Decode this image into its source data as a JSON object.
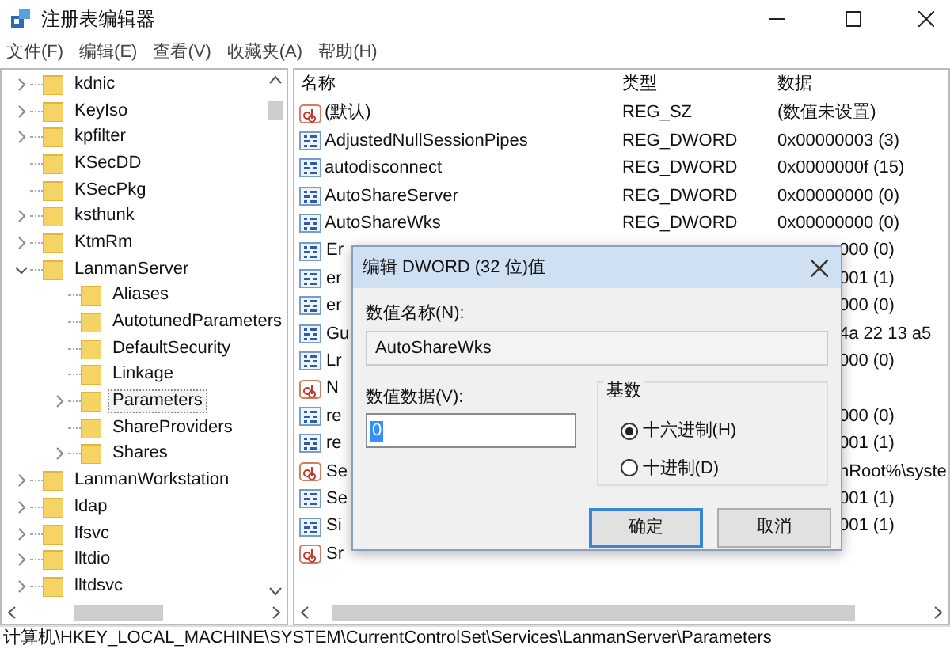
{
  "window": {
    "title": "注册表编辑器"
  },
  "menu": [
    "文件(F)",
    "编辑(E)",
    "查看(V)",
    "收藏夹(A)",
    "帮助(H)"
  ],
  "tree": [
    {
      "label": "kdnic",
      "expandable": true,
      "expanded": false,
      "selected": false
    },
    {
      "label": "KeyIso",
      "expandable": true,
      "expanded": false,
      "selected": false
    },
    {
      "label": "kpfilter",
      "expandable": true,
      "expanded": false,
      "selected": false
    },
    {
      "label": "KSecDD",
      "expandable": false,
      "expanded": false,
      "selected": false
    },
    {
      "label": "KSecPkg",
      "expandable": false,
      "expanded": false,
      "selected": false
    },
    {
      "label": "ksthunk",
      "expandable": true,
      "expanded": false,
      "selected": false
    },
    {
      "label": "KtmRm",
      "expandable": true,
      "expanded": false,
      "selected": false
    },
    {
      "label": "LanmanServer",
      "expandable": true,
      "expanded": true,
      "selected": false,
      "children": [
        {
          "label": "Aliases",
          "expandable": false,
          "expanded": false,
          "selected": false
        },
        {
          "label": "AutotunedParameters",
          "expandable": false,
          "expanded": false,
          "selected": false
        },
        {
          "label": "DefaultSecurity",
          "expandable": false,
          "expanded": false,
          "selected": false
        },
        {
          "label": "Linkage",
          "expandable": false,
          "expanded": false,
          "selected": false
        },
        {
          "label": "Parameters",
          "expandable": true,
          "expanded": false,
          "selected": true
        },
        {
          "label": "ShareProviders",
          "expandable": false,
          "expanded": false,
          "selected": false
        },
        {
          "label": "Shares",
          "expandable": true,
          "expanded": false,
          "selected": false
        }
      ]
    },
    {
      "label": "LanmanWorkstation",
      "expandable": true,
      "expanded": false,
      "selected": false
    },
    {
      "label": "ldap",
      "expandable": true,
      "expanded": false,
      "selected": false
    },
    {
      "label": "lfsvc",
      "expandable": true,
      "expanded": false,
      "selected": false
    },
    {
      "label": "lltdio",
      "expandable": true,
      "expanded": false,
      "selected": false
    },
    {
      "label": "lltdsvc",
      "expandable": true,
      "expanded": false,
      "selected": false
    }
  ],
  "table": {
    "columns": [
      "名称",
      "类型",
      "数据"
    ],
    "rows": [
      {
        "kind": "string",
        "name": "(默认)",
        "type": "REG_SZ",
        "data": "(数值未设置)"
      },
      {
        "kind": "dword",
        "name": "AdjustedNullSessionPipes",
        "type": "REG_DWORD",
        "data": "0x00000003 (3)"
      },
      {
        "kind": "dword",
        "name": "autodisconnect",
        "type": "REG_DWORD",
        "data": "0x0000000f (15)"
      },
      {
        "kind": "dword",
        "name": "AutoShareServer",
        "type": "REG_DWORD",
        "data": "0x00000000 (0)"
      },
      {
        "kind": "dword",
        "name": "AutoShareWks",
        "type": "REG_DWORD",
        "data": "0x00000000 (0)"
      }
    ],
    "rows_behind_dialog": [
      {
        "kind": "dword",
        "name": "Er",
        "data": "000 (0)"
      },
      {
        "kind": "dword",
        "name": "er",
        "data": "001 (1)"
      },
      {
        "kind": "dword",
        "name": "er",
        "data": "000 (0)"
      },
      {
        "kind": "dword",
        "name": "Gu",
        "data": "4a 22 13 a5"
      },
      {
        "kind": "dword",
        "name": "Lr",
        "data": "000 (0)"
      },
      {
        "kind": "string",
        "name": "N"
      },
      {
        "kind": "dword",
        "name": "re",
        "data": "000 (0)"
      },
      {
        "kind": "dword",
        "name": "re",
        "data": "001 (1)"
      },
      {
        "kind": "string",
        "name": "Se",
        "data": "nRoot%\\syste"
      },
      {
        "kind": "dword",
        "name": "Se",
        "data": "001 (1)"
      },
      {
        "kind": "dword",
        "name": "Si",
        "data": "001 (1)"
      },
      {
        "kind": "string",
        "name": "Sr"
      }
    ]
  },
  "dialog": {
    "title": "编辑 DWORD (32 位)值",
    "name_label": "数值名称(N):",
    "name_value": "AutoShareWks",
    "data_label": "数值数据(V):",
    "data_value": "0",
    "base_label": "基数",
    "radios": [
      {
        "label": "十六进制(H)",
        "selected": true
      },
      {
        "label": "十进制(D)",
        "selected": false
      }
    ],
    "buttons": [
      {
        "label": "确定",
        "focused": true
      },
      {
        "label": "取消",
        "focused": false
      }
    ]
  },
  "status_bar": "计算机\\HKEY_LOCAL_MACHINE\\SYSTEM\\CurrentControlSet\\Services\\LanmanServer\\Parameters"
}
